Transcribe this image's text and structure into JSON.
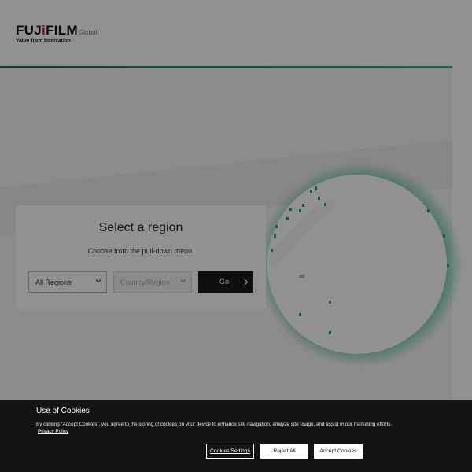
{
  "header": {
    "logo_word_a": "FUJ",
    "logo_word_i": "i",
    "logo_word_b": "FILM",
    "logo_tagline": "Value from Innovation",
    "site_label": "Global"
  },
  "region_panel": {
    "title": "Select a region",
    "subtitle": "Choose from the pull-down menu.",
    "region_select": {
      "selected": "All Regions"
    },
    "country_select": {
      "placeholder": "Country/Region"
    },
    "go_label": "Go"
  },
  "cookie_banner": {
    "title": "Use of Cookies",
    "text": "By clicking “Accept Cookies”, you agree to the storing of cookies on your device to enhance site navigation, analyze site usage, and assist in our marketing efforts.",
    "privacy_link": "Privacy Policy",
    "settings_label": "Cookies Settings",
    "reject_label": "Reject All",
    "accept_label": "Accept Cookies"
  },
  "colors": {
    "accent_green": "#0f7a3c",
    "accent_teal": "#27b3a4",
    "logo_red": "#c8102e",
    "globe_glow": "#3fbf8f",
    "banner_bg": "#141414"
  },
  "icons": [
    "chevron-down-icon",
    "chevron-right-icon",
    "globe-illustration"
  ]
}
